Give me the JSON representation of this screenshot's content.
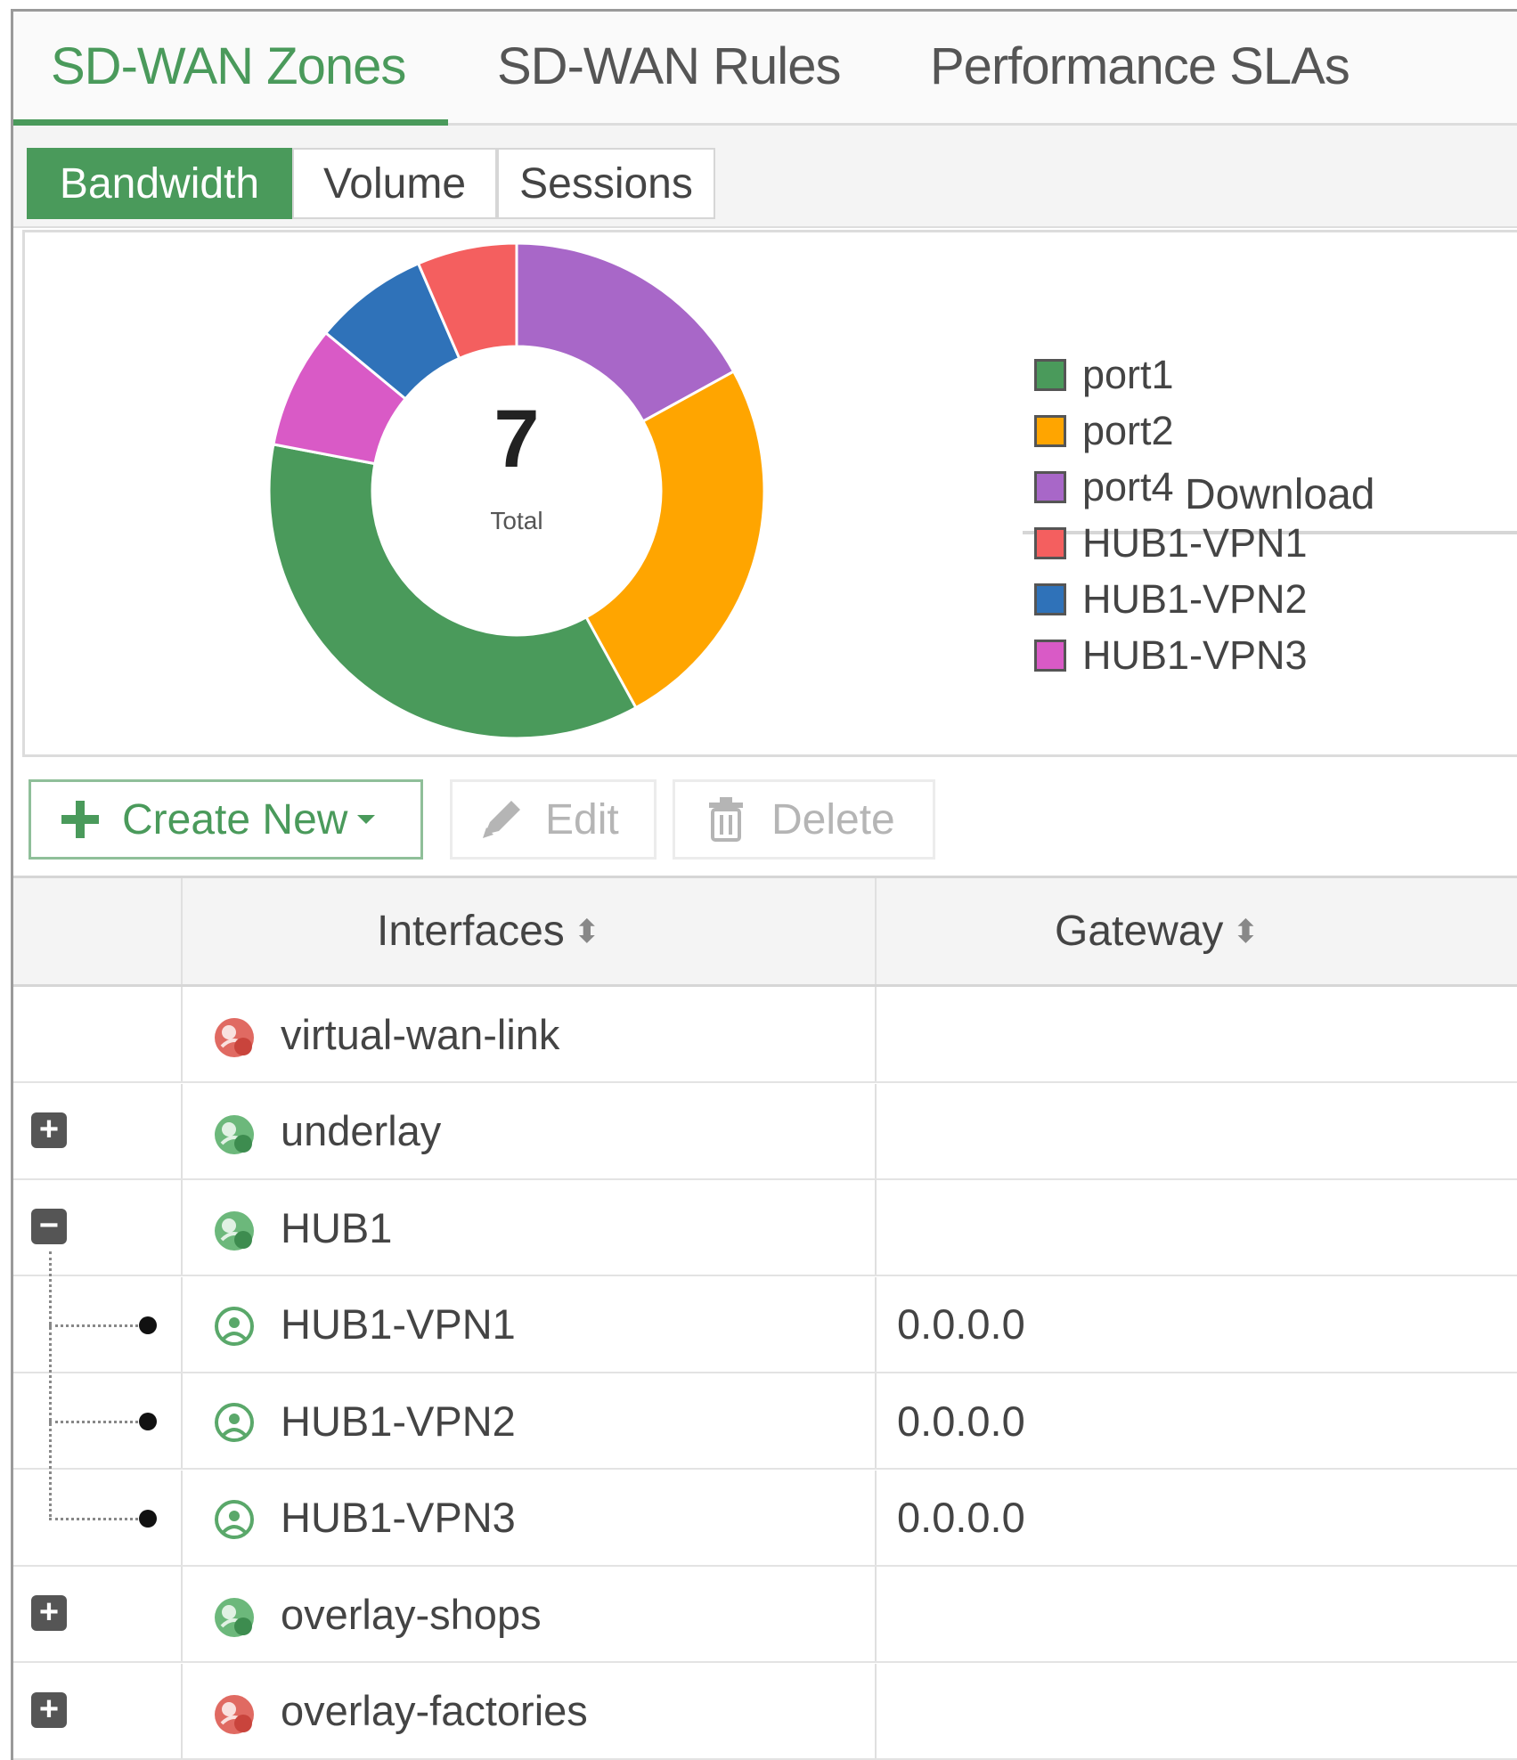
{
  "top_tabs": [
    "SD-WAN Zones",
    "SD-WAN Rules",
    "Performance SLAs"
  ],
  "sub_tabs": [
    "Bandwidth",
    "Volume",
    "Sessions"
  ],
  "chart_data": {
    "type": "pie",
    "center_value": "7",
    "center_label": "Total",
    "legend_title": "Download",
    "categories": [
      "port1",
      "port2",
      "port4",
      "HUB1-VPN1",
      "HUB1-VPN2",
      "HUB1-VPN3"
    ],
    "values": [
      36,
      25,
      17,
      6.5,
      7.5,
      8
    ],
    "colors": [
      "#4a9a5b",
      "#ffa500",
      "#a867c8",
      "#f45f5f",
      "#2f72b9",
      "#d95ac6"
    ]
  },
  "toolbar": {
    "create_label": "Create New",
    "edit_label": "Edit",
    "delete_label": "Delete"
  },
  "table": {
    "columns": [
      "Interfaces",
      "Gateway"
    ],
    "rows": [
      {
        "name": "virtual-wan-link",
        "gateway": "",
        "icon": "zone-red-icon",
        "expander": ""
      },
      {
        "name": "underlay",
        "gateway": "",
        "icon": "zone-green-icon",
        "expander": "+"
      },
      {
        "name": "HUB1",
        "gateway": "",
        "icon": "zone-green-icon",
        "expander": "−"
      },
      {
        "name": "HUB1-VPN1",
        "gateway": "0.0.0.0",
        "icon": "tunnel-icon",
        "expander": ""
      },
      {
        "name": "HUB1-VPN2",
        "gateway": "0.0.0.0",
        "icon": "tunnel-icon",
        "expander": ""
      },
      {
        "name": "HUB1-VPN3",
        "gateway": "0.0.0.0",
        "icon": "tunnel-icon",
        "expander": ""
      },
      {
        "name": "overlay-shops",
        "gateway": "",
        "icon": "zone-green-icon",
        "expander": "+"
      },
      {
        "name": "overlay-factories",
        "gateway": "",
        "icon": "zone-red-icon",
        "expander": "+"
      }
    ]
  }
}
